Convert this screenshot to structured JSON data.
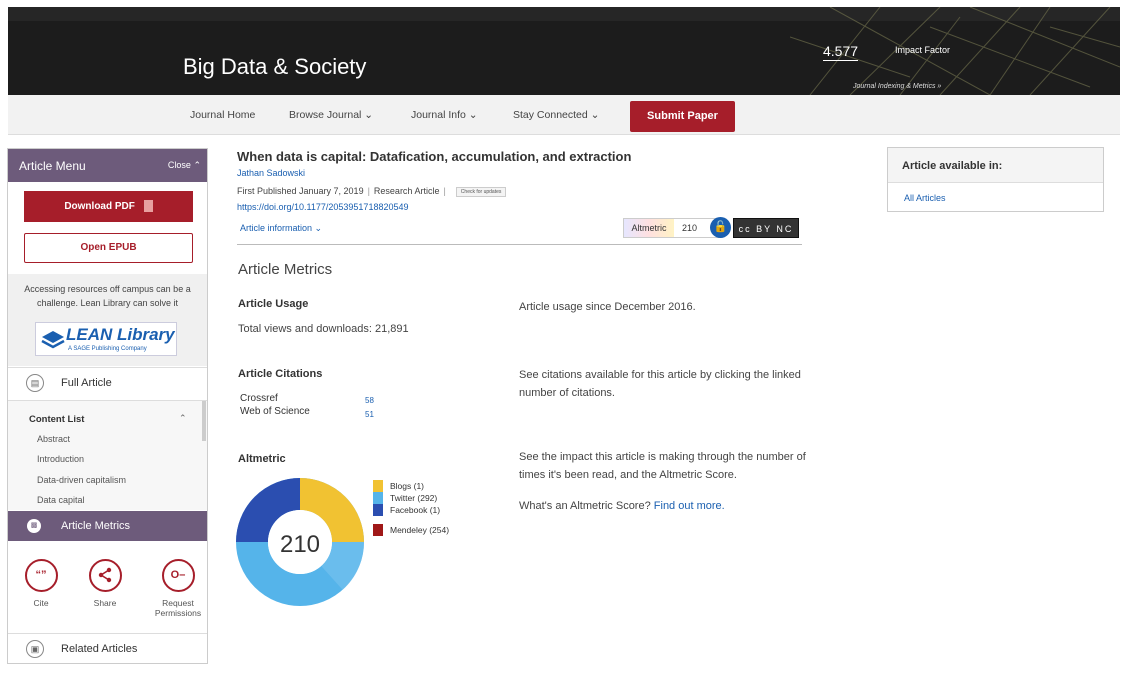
{
  "header": {
    "journal_title": "Big Data & Society",
    "impact_factor": "4.577",
    "impact_label": "Impact Factor",
    "indexing_link": "Journal Indexing & Metrics »"
  },
  "nav": {
    "items": [
      "Journal Home",
      "Browse Journal",
      "Journal Info",
      "Stay Connected"
    ],
    "submit_label": "Submit Paper"
  },
  "sidebar": {
    "title": "Article Menu",
    "close_label": "Close",
    "download_pdf": "Download PDF",
    "open_epub": "Open EPUB",
    "lean_text": "Accessing resources off campus can be a challenge. Lean Library can solve it",
    "lean_logo": "LEAN Library",
    "lean_sub": "A SAGE Publishing Company",
    "full_article": "Full Article",
    "content_list_title": "Content List",
    "content_list": [
      "Abstract",
      "Introduction",
      "Data-driven capitalism",
      "Data capital"
    ],
    "article_metrics": "Article Metrics",
    "actions": [
      {
        "label": "Cite",
        "icon": "quote-icon"
      },
      {
        "label": "Share",
        "icon": "share-icon"
      },
      {
        "label": "Request Permissions",
        "icon": "key-icon"
      }
    ],
    "related_articles": "Related Articles"
  },
  "article": {
    "title": "When data is capital: Datafication, accumulation, and extraction",
    "author": "Jathan Sadowski",
    "first_published": "First Published January 7, 2019",
    "type": "Research Article",
    "check_updates": "Check for updates",
    "doi": "https://doi.org/10.1177/2053951718820549",
    "article_info": "Article information",
    "altmetric_label": "Altmetric",
    "altmetric_score": "210",
    "license": "cc BY NC"
  },
  "metrics": {
    "heading": "Article Metrics",
    "usage_heading": "Article Usage",
    "usage_total": "Total views and downloads: 21,891",
    "usage_since": "Article usage since December 2016.",
    "citations_heading": "Article Citations",
    "citations": [
      {
        "source": "Crossref",
        "count": "58"
      },
      {
        "source": "Web of Science",
        "count": "51"
      }
    ],
    "citations_text": "See citations available for this article by clicking the linked number of citations.",
    "altmetric_heading": "Altmetric",
    "altmetric_text": "See the impact this article is making through the number of times it's been read, and the Altmetric Score.",
    "altmetric_question": "What's an Altmetric Score?",
    "find_out_more": "Find out more.",
    "donut_score": "210",
    "legend": [
      {
        "label": "Blogs (1)",
        "color": "#f1c232"
      },
      {
        "label": "Twitter (292)",
        "color": "#55b4ea"
      },
      {
        "label": "Facebook (1)",
        "color": "#2b4eb0"
      },
      {
        "label": "Mendeley (254)",
        "color": "#a01818"
      }
    ]
  },
  "rightbox": {
    "heading": "Article available in:",
    "link": "All Articles"
  }
}
